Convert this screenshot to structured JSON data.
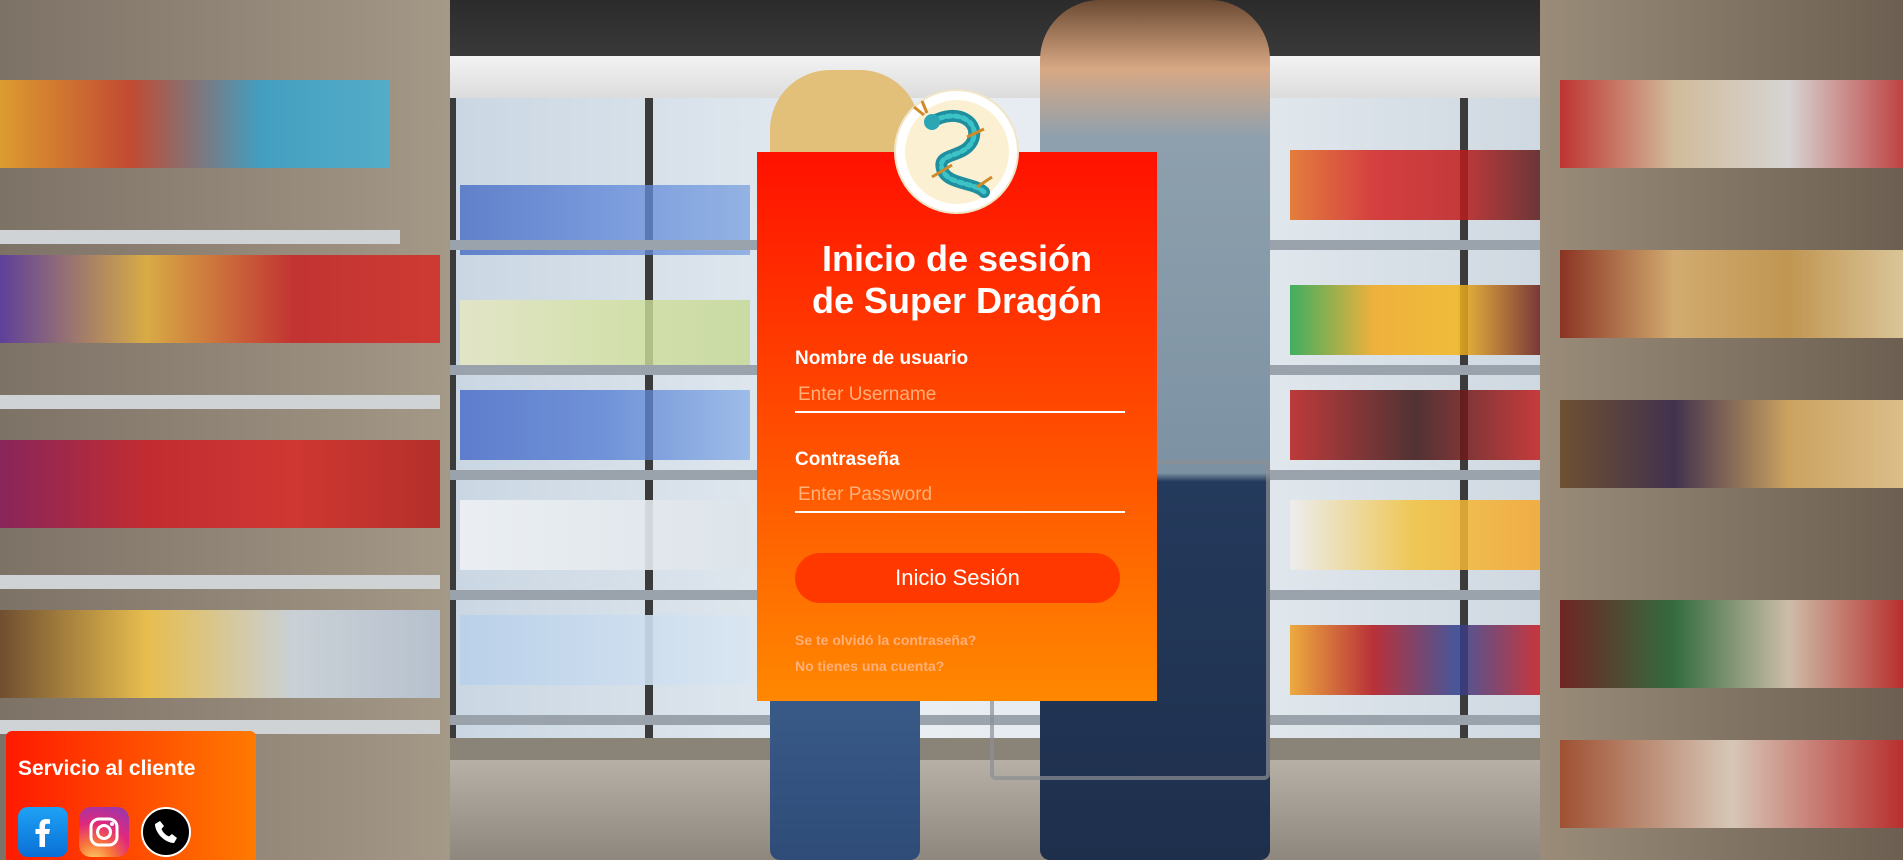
{
  "login": {
    "title_line1": "Inicio de sesión",
    "title_line2": "de Super Dragón",
    "username_label": "Nombre de usuario",
    "username_placeholder": "Enter Username",
    "username_value": "",
    "password_label": "Contraseña",
    "password_placeholder": "Enter Password",
    "password_value": "",
    "submit_label": "Inicio Sesión",
    "forgot_password_link": "Se te olvidó la contraseña?",
    "no_account_link": "No tienes una cuenta?",
    "logo_icon": "dragon-icon"
  },
  "customer_service": {
    "title": "Servicio al cliente",
    "icons": [
      "facebook-icon",
      "instagram-icon",
      "phone-icon"
    ]
  },
  "colors": {
    "card_gradient_top": "#ff1100",
    "card_gradient_bottom": "#ff8800",
    "button": "#ff3800",
    "link": "#ffb07a"
  }
}
